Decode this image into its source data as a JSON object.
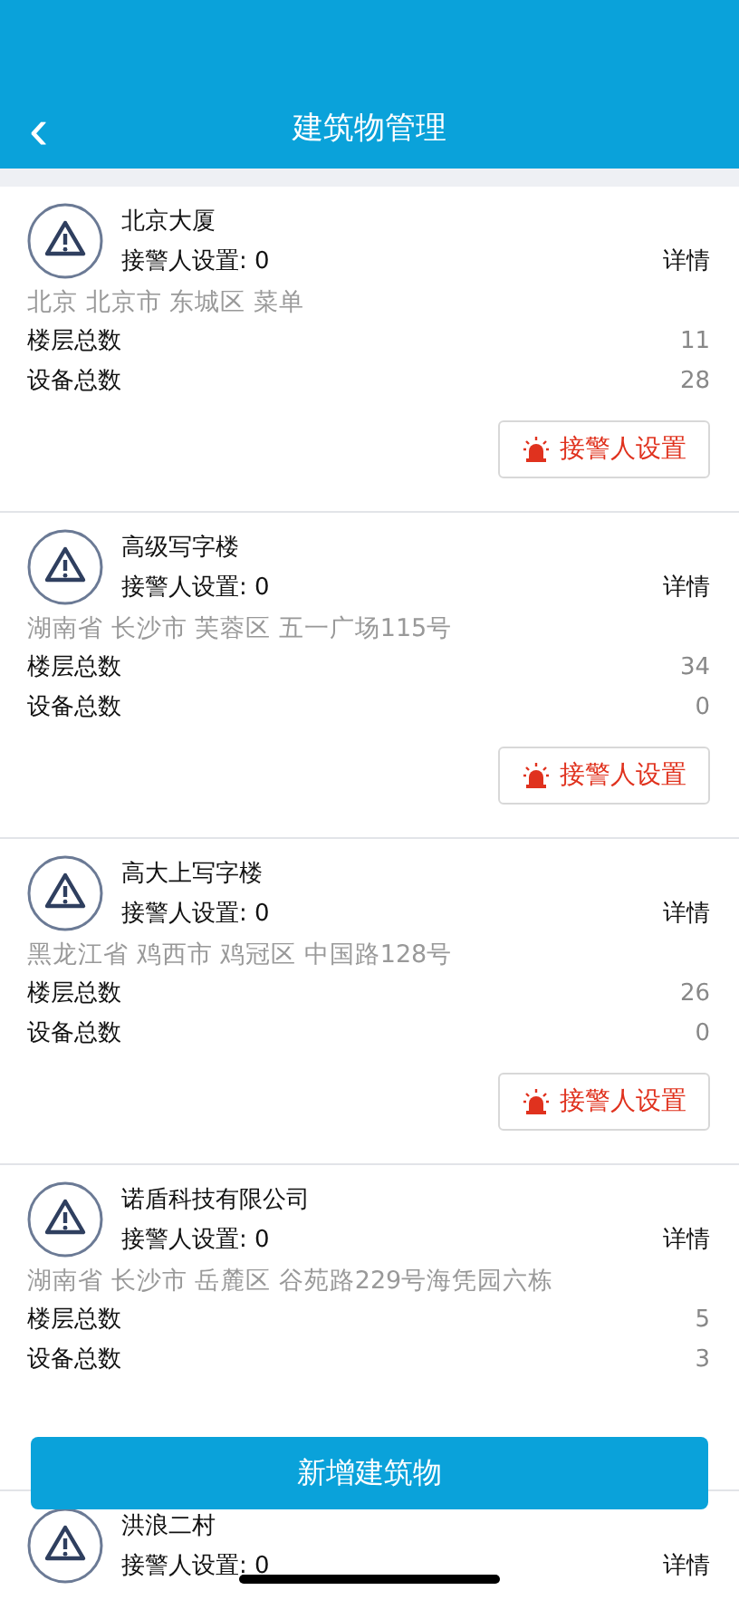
{
  "header": {
    "title": "建筑物管理",
    "back": "‹"
  },
  "buildings": [
    {
      "name": "北京大厦",
      "alarm_contacts": "接警人设置: 0",
      "detail": "详情",
      "address": "北京 北京市 东城区 菜单",
      "floors_label": "楼层总数",
      "floors": "11",
      "devices_label": "设备总数",
      "devices": "28",
      "alarm_button": "接警人设置"
    },
    {
      "name": "高级写字楼",
      "alarm_contacts": "接警人设置: 0",
      "detail": "详情",
      "address": "湖南省 长沙市 芙蓉区 五一广场115号",
      "floors_label": "楼层总数",
      "floors": "34",
      "devices_label": "设备总数",
      "devices": "0",
      "alarm_button": "接警人设置"
    },
    {
      "name": "高大上写字楼",
      "alarm_contacts": "接警人设置: 0",
      "detail": "详情",
      "address": "黑龙江省 鸡西市 鸡冠区 中国路128号",
      "floors_label": "楼层总数",
      "floors": "26",
      "devices_label": "设备总数",
      "devices": "0",
      "alarm_button": "接警人设置"
    },
    {
      "name": "诺盾科技有限公司",
      "alarm_contacts": "接警人设置: 0",
      "detail": "详情",
      "address": "湖南省 长沙市 岳麓区 谷苑路229号海凭园六栋",
      "floors_label": "楼层总数",
      "floors": "5",
      "devices_label": "设备总数",
      "devices": "3"
    },
    {
      "name": "洪浪二村",
      "alarm_contacts": "接警人设置: 0",
      "detail": "详情"
    }
  ],
  "add_button": "新增建筑物"
}
